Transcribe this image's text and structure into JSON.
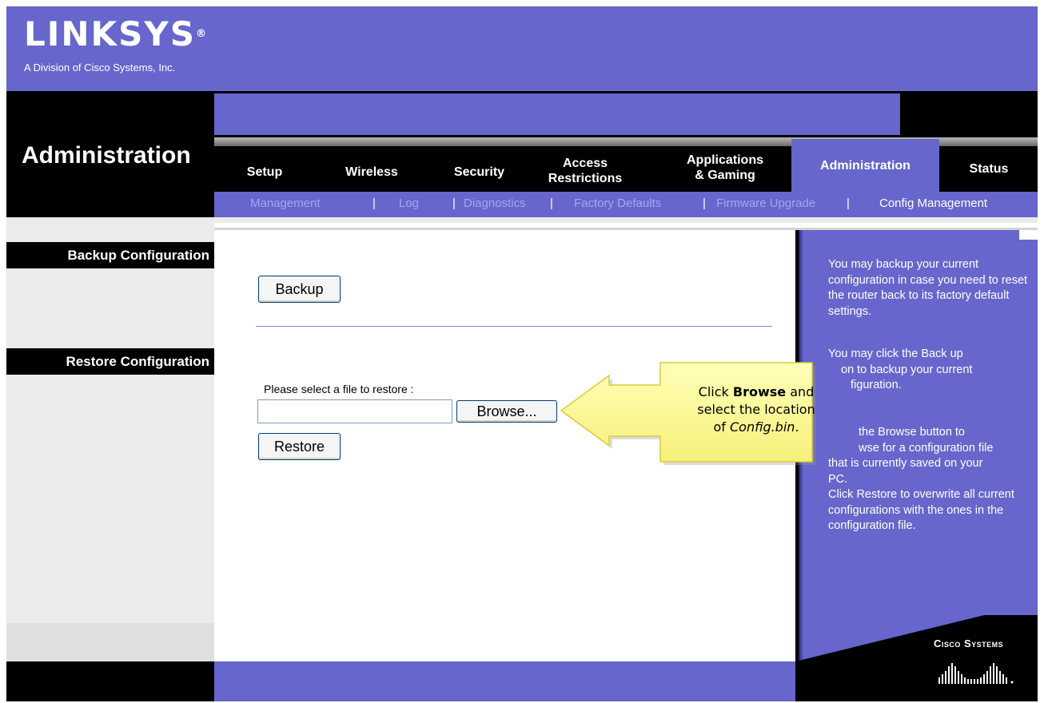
{
  "brand": {
    "logo_text": "LINKSYS",
    "logo_mark": "®",
    "tagline": "A Division of Cisco Systems, Inc.",
    "footer_logo": "Cisco Systems"
  },
  "page_title": "Administration",
  "tabs": {
    "setup": "Setup",
    "wireless": "Wireless",
    "security": "Security",
    "access_line1": "Access",
    "access_line2": "Restrictions",
    "apps_line1": "Applications",
    "apps_line2": "& Gaming",
    "administration": "Administration",
    "status": "Status"
  },
  "subnav": {
    "management": "Management",
    "log": "Log",
    "diagnostics": "Diagnostics",
    "factory_defaults": "Factory Defaults",
    "firmware_upgrade": "Firmware Upgrade",
    "config_management": "Config Management",
    "separator": "|"
  },
  "sections": {
    "backup": "Backup Configuration",
    "restore": "Restore Configuration"
  },
  "main": {
    "backup_button": "Backup",
    "restore_label": "Please select a file to restore :",
    "file_value": "",
    "browse_button": "Browse...",
    "restore_button": "Restore"
  },
  "help": {
    "p1": "You may backup your current configuration in case you need to reset the router back to its factory default settings.",
    "p2_a": "You may click the Back up",
    "p2_b": "on to backup your current",
    "p2_c": "figuration.",
    "p3_a": "the Browse button to",
    "p3_b": "wse for a configuration file",
    "p3_c": "that is currently saved on your",
    "p3_d": "PC.",
    "p3_e": "Click Restore to overwrite all current configurations with the ones in the configuration file."
  },
  "callout": {
    "line1_pre": "Click ",
    "line1_bold": "Browse",
    "line1_post": " and",
    "line2": "select the location",
    "line3_pre": "of ",
    "line3_italic": "Config.bin",
    "line3_post": "."
  },
  "colors": {
    "brand_purple": "#6666cc",
    "black": "#000000",
    "callout_fill": "#ffff99"
  },
  "icons": {
    "callout_arrow": "arrow-left-icon",
    "cisco_bars": "cisco-bridge-icon"
  }
}
